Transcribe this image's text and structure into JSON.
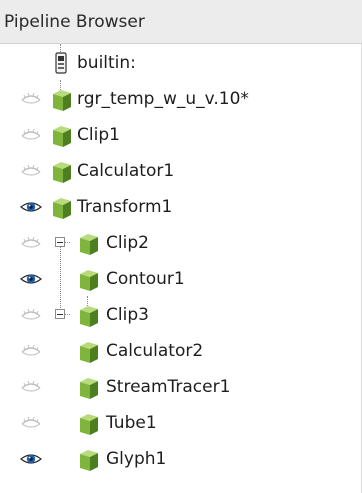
{
  "panel": {
    "title": "Pipeline Browser"
  },
  "tree": {
    "root": {
      "label": "builtin:"
    },
    "items": [
      {
        "label": "rgr_temp_w_u_v.10*",
        "visible": false
      },
      {
        "label": "Clip1",
        "visible": false
      },
      {
        "label": "Calculator1",
        "visible": false
      },
      {
        "label": "Transform1",
        "visible": true
      },
      {
        "label": "Clip2",
        "visible": false,
        "expanded": true
      },
      {
        "label": "Contour1",
        "visible": true
      },
      {
        "label": "Clip3",
        "visible": false,
        "expanded": true
      },
      {
        "label": "Calculator2",
        "visible": false
      },
      {
        "label": "StreamTracer1",
        "visible": false
      },
      {
        "label": "Tube1",
        "visible": false
      },
      {
        "label": "Glyph1",
        "visible": true
      }
    ]
  },
  "icons": {
    "visible": "eye-open-icon",
    "hidden": "eye-closed-icon",
    "source": "green-cube-icon",
    "server": "server-icon",
    "expand": "collapse-minus-icon"
  },
  "colors": {
    "cube_front": "#7fb53c",
    "cube_top": "#b8dc7c",
    "cube_side": "#4d7f20",
    "eye_iris": "#1f5fae"
  }
}
